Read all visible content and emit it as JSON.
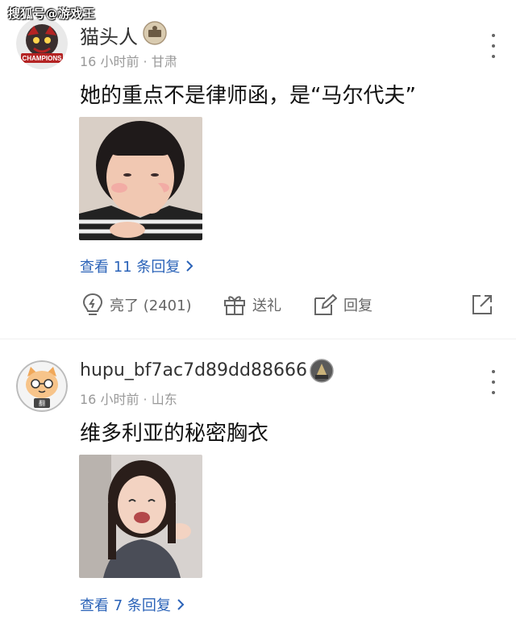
{
  "watermark": "搜狐号@游戏王",
  "comments": [
    {
      "username": "猫头人",
      "avatar_icon": "champions-avatar-icon",
      "badge_icon": "badge-icon",
      "time": "16 小时前",
      "separator": "·",
      "location": "甘肃",
      "text": "她的重点不是律师函，是“马尔代夫”",
      "image_icon": "reaction-image",
      "replies_label": "查看 11 条回复",
      "actions": {
        "light_label": "亮了 (2401)",
        "gift_label": "送礼",
        "reply_label": "回复"
      }
    },
    {
      "username": "hupu_bf7ac7d89dd88666",
      "avatar_icon": "cat-avatar-icon",
      "badge_icon": "badge-icon",
      "time": "16 小时前",
      "separator": "·",
      "location": "山东",
      "text": "维多利亚的秘密胸衣",
      "image_icon": "reaction-image",
      "replies_label": "查看 7 条回复"
    }
  ],
  "colors": {
    "link": "#2b63b8",
    "meta": "#999999",
    "action": "#666666"
  }
}
